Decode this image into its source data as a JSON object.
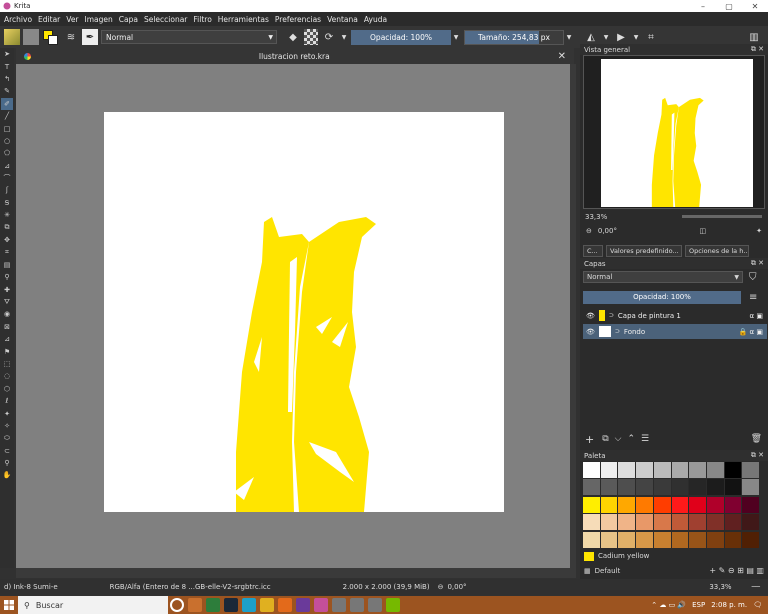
{
  "window": {
    "title": "Krita"
  },
  "menu": [
    "Archivo",
    "Editar",
    "Ver",
    "Imagen",
    "Capa",
    "Seleccionar",
    "Filtro",
    "Herramientas",
    "Preferencias",
    "Ventana",
    "Ayuda"
  ],
  "toolbar": {
    "blend_mode": "Normal",
    "opacity": "Opacidad: 100%",
    "size": "Tamaño: 254,83 px",
    "size_fraction": 0.75
  },
  "document": {
    "title": "Ilustracion reto.kra"
  },
  "overview": {
    "title": "Vista general",
    "zoom": "33,3%",
    "rotation": "0,00°"
  },
  "dock_tabs": [
    "C...",
    "Valores predefinido...",
    "Opciones de la h..."
  ],
  "layers": {
    "title": "Capas",
    "blend_mode": "Normal",
    "opacity": "Opacidad:  100%",
    "items": [
      {
        "name": "Capa de pintura 1",
        "selected": false
      },
      {
        "name": "Fondo",
        "selected": true
      }
    ]
  },
  "palette": {
    "title": "Paleta",
    "current_color": "Cadium yellow",
    "name": "Default",
    "colors": [
      "#ffffff",
      "#eeeeee",
      "#dddddd",
      "#cccccc",
      "#bbbbbb",
      "#aaaaaa",
      "#999999",
      "#888888",
      "#000000",
      "#777777",
      "#666666",
      "#5a5a5a",
      "#4e4e4e",
      "#444444",
      "#3a3a3a",
      "#303030",
      "#262626",
      "#1c1c1c",
      "#121212",
      "#888888",
      "#ffee00",
      "#ffd400",
      "#ffa800",
      "#ff7a00",
      "#ff3d00",
      "#ff1a1a",
      "#e0001a",
      "#b0002a",
      "#800030",
      "#500020",
      "#f6dcb8",
      "#f3c9a0",
      "#f0b488",
      "#e89868",
      "#d8784a",
      "#c05a38",
      "#a04030",
      "#803028",
      "#602020",
      "#401818",
      "#f0d8a8",
      "#e8c488",
      "#e0b068",
      "#d89848",
      "#c88030",
      "#b06820",
      "#985418",
      "#804010",
      "#683008",
      "#502004"
    ],
    "brand": "#ffe500"
  },
  "status": {
    "brush": "d) Ink-8 Sumi-e",
    "colorspace": "RGB/Alfa (Entero de 8 ...GB-elle-V2-srgbtrc.icc",
    "dims": "2.000 x 2.000 (39,9 MiB)",
    "rotation": "0,00°",
    "zoom": "33,3%"
  },
  "taskbar": {
    "search": "Buscar",
    "lang": "ESP",
    "time": "2:08 p. m."
  }
}
